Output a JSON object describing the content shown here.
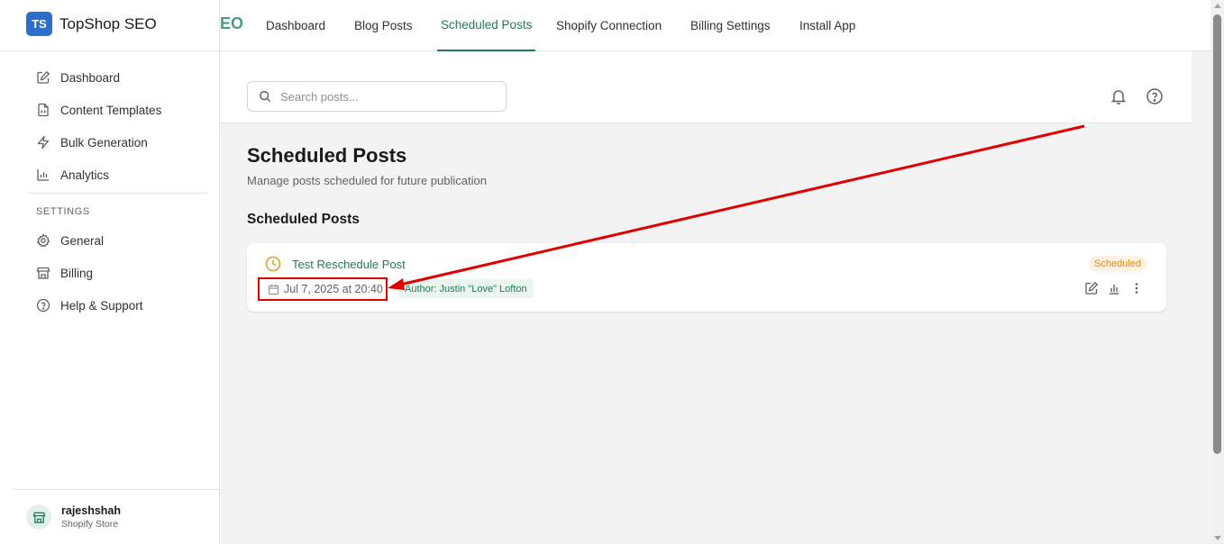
{
  "app": {
    "logo_text": "TS",
    "name": "TopShop SEO"
  },
  "sidebar": {
    "items": [
      {
        "label": "Dashboard",
        "icon": "edit-icon"
      },
      {
        "label": "Content Templates",
        "icon": "file-code-icon"
      },
      {
        "label": "Bulk Generation",
        "icon": "lightning-icon"
      },
      {
        "label": "Analytics",
        "icon": "bar-chart-icon"
      }
    ],
    "settings_label": "SETTINGS",
    "settings_items": [
      {
        "label": "General",
        "icon": "gear-icon"
      },
      {
        "label": "Billing",
        "icon": "store-icon"
      },
      {
        "label": "Help & Support",
        "icon": "help-circle-icon"
      }
    ],
    "user": {
      "name": "rajeshshah",
      "subtitle": "Shopify Store",
      "icon": "store-icon"
    }
  },
  "topnav": {
    "brand_fragment": "EO",
    "tabs": [
      {
        "label": "Dashboard",
        "active": false
      },
      {
        "label": "Blog Posts",
        "active": false
      },
      {
        "label": "Scheduled Posts",
        "active": true
      },
      {
        "label": "Shopify Connection",
        "active": false
      },
      {
        "label": "Billing Settings",
        "active": false
      },
      {
        "label": "Install App",
        "active": false
      }
    ]
  },
  "toolbar": {
    "search_placeholder": "Search posts...",
    "search_value": "",
    "icons": [
      "bell-icon",
      "help-circle-icon"
    ]
  },
  "main": {
    "title": "Scheduled Posts",
    "subtitle": "Manage posts scheduled for future publication",
    "section_title": "Scheduled Posts",
    "posts": [
      {
        "title": "Test Reschedule Post",
        "date": "Jul 7, 2025 at 20:40",
        "author": "Author: Justin \"Love\" Lofton",
        "status": "Scheduled",
        "actions": [
          "edit-icon",
          "bar-chart-icon",
          "more-vertical-icon"
        ]
      }
    ]
  },
  "colors": {
    "brand_blue": "#2c6ecb",
    "accent_green": "#1e7b55",
    "status_orange": "#d78a24",
    "annotation_red": "#e00000"
  }
}
